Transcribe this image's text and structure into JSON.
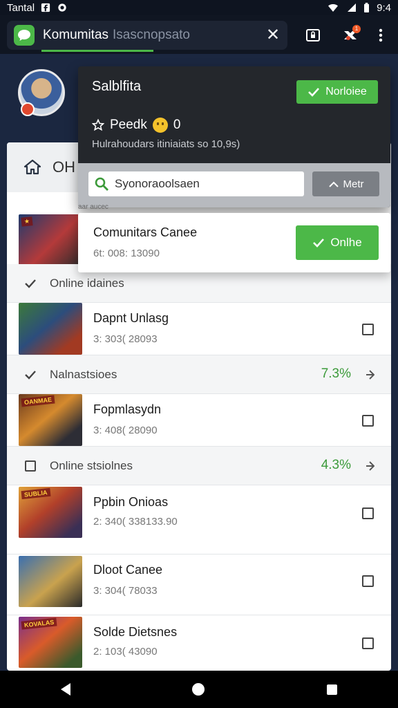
{
  "status_bar": {
    "carrier": "Tantal",
    "time": "9:4"
  },
  "app_bar": {
    "title": "Komumitas",
    "subtitle": "Isascnopsato"
  },
  "background_header": {
    "title": "OH"
  },
  "popup": {
    "title": "Salblfita",
    "button": "Norloiee",
    "stat_label": "Peedk",
    "stat_value": "0",
    "description": "Hulrahoudars itiniaiats so 10,9s)",
    "search_value": "Syonoraoolsaen",
    "more_button": "Metr"
  },
  "featured": {
    "strip_text": "aar aucec",
    "name": "Comunitars Canee",
    "meta": "6t: 008: 13090",
    "button": "Onlhe"
  },
  "section_1": {
    "label": "Online idaines"
  },
  "games": [
    {
      "name": "Dapnt Unlasg",
      "meta": "3: 303( 28093",
      "tag": ""
    },
    {
      "name": "Fopmlasydn",
      "meta": "3: 408( 28090",
      "tag": "OANMAE"
    },
    {
      "name": "Ppbin Onioas",
      "meta": "2: 340( 338133.90",
      "tag": "SUBLIA"
    },
    {
      "name": "Dloot Canee",
      "meta": "3: 304( 78033",
      "tag": ""
    },
    {
      "name": "Solde Dietsnes",
      "meta": "2: 103( 43090",
      "tag": "KOVALAS"
    }
  ],
  "section_2": {
    "label": "Nalnastsioes",
    "pct": "7.3%"
  },
  "section_3": {
    "label": "Online stsiolnes",
    "pct": "4.3%"
  },
  "colors": {
    "accent": "#4cb848",
    "header_bg": "#101622",
    "popup_bg": "#24272c"
  }
}
